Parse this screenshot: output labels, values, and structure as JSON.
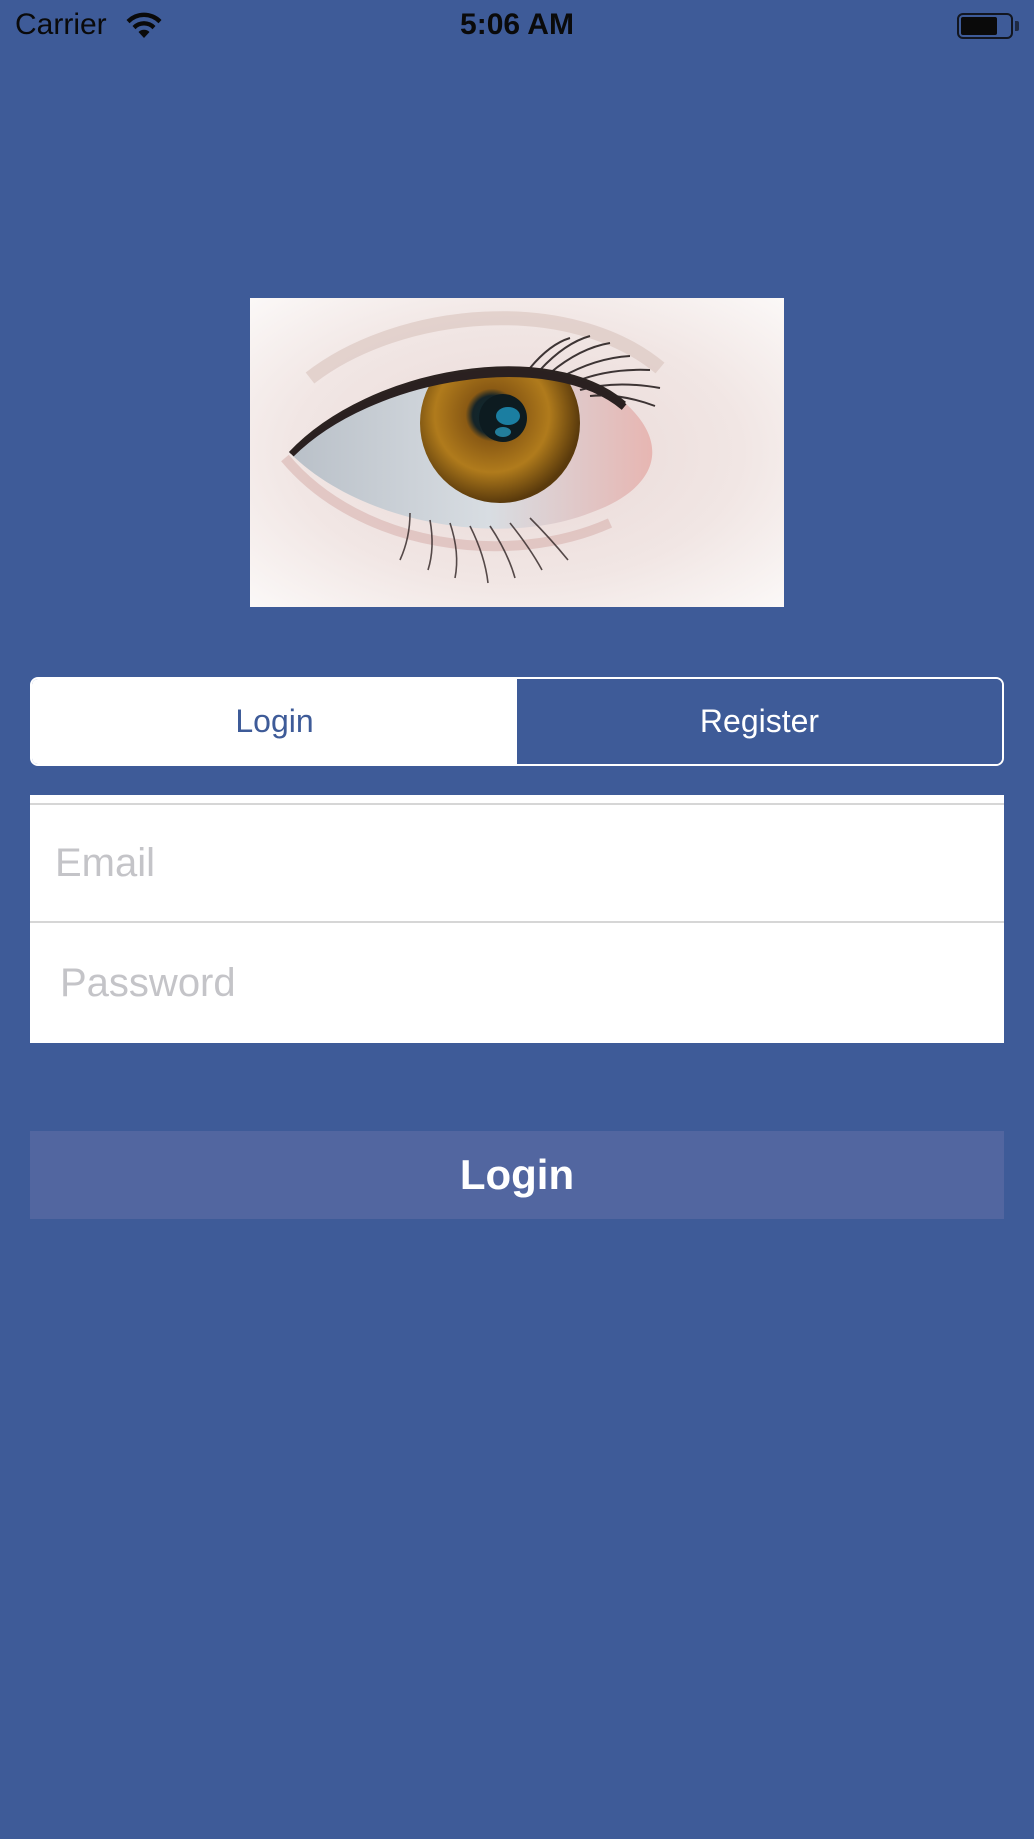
{
  "status_bar": {
    "carrier": "Carrier",
    "time": "5:06 AM",
    "wifi_icon": "wifi-icon",
    "battery_icon": "battery-icon"
  },
  "hero": {
    "image": "eye-closeup-photo"
  },
  "tabs": {
    "login_label": "Login",
    "register_label": "Register",
    "selected": "Login"
  },
  "form": {
    "email_placeholder": "Email",
    "password_placeholder": "Password"
  },
  "actions": {
    "login_button_label": "Login"
  },
  "colors": {
    "background": "#3e5b98",
    "button": "#5266a0",
    "field_bg": "#ffffff",
    "placeholder": "#c4c4c8"
  }
}
